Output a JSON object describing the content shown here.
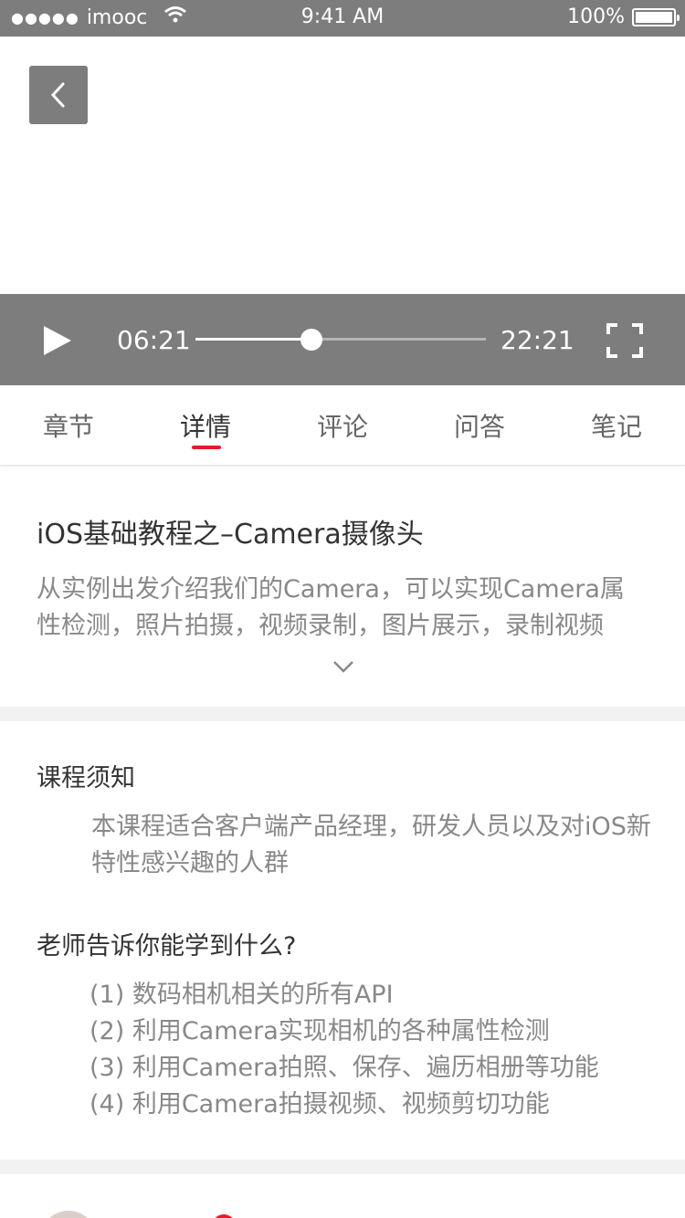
{
  "status_bar": {
    "signal_dots": "●●●●●",
    "carrier": "imooc",
    "time": "9:41 AM",
    "battery": "100%",
    "battery_level": 1.0
  },
  "player": {
    "current_time": "06:21",
    "total_time": "22:21",
    "progress": 0.4
  },
  "tabs": [
    {
      "label": "章节",
      "active": false
    },
    {
      "label": "详情",
      "active": true
    },
    {
      "label": "评论",
      "active": false
    },
    {
      "label": "问答",
      "active": false
    },
    {
      "label": "笔记",
      "active": false
    }
  ],
  "course": {
    "title": "iOS基础教程之–Camera摄像头",
    "description": "从实例出发介绍我们的Camera，可以实现Camera属性检测，照片拍摄，视频录制，图片展示，录制视频"
  },
  "notice": {
    "title": "课程须知",
    "text": "本课程适合客户端产品经理，研发人员以及对iOS新特性感兴趣的人群"
  },
  "learn": {
    "title": "老师告诉你能学到什么?",
    "items": [
      "(1) 数码相机相关的所有API",
      "(2) 利用Camera实现相机的各种属性检测",
      "(3) 利用Camera拍照、保存、遍历相册等功能",
      "(4) 利用Camera拍摄视频、视频剪切功能"
    ]
  },
  "colors": {
    "accent": "#e8192c",
    "bar_gray": "#7d7d7d"
  }
}
